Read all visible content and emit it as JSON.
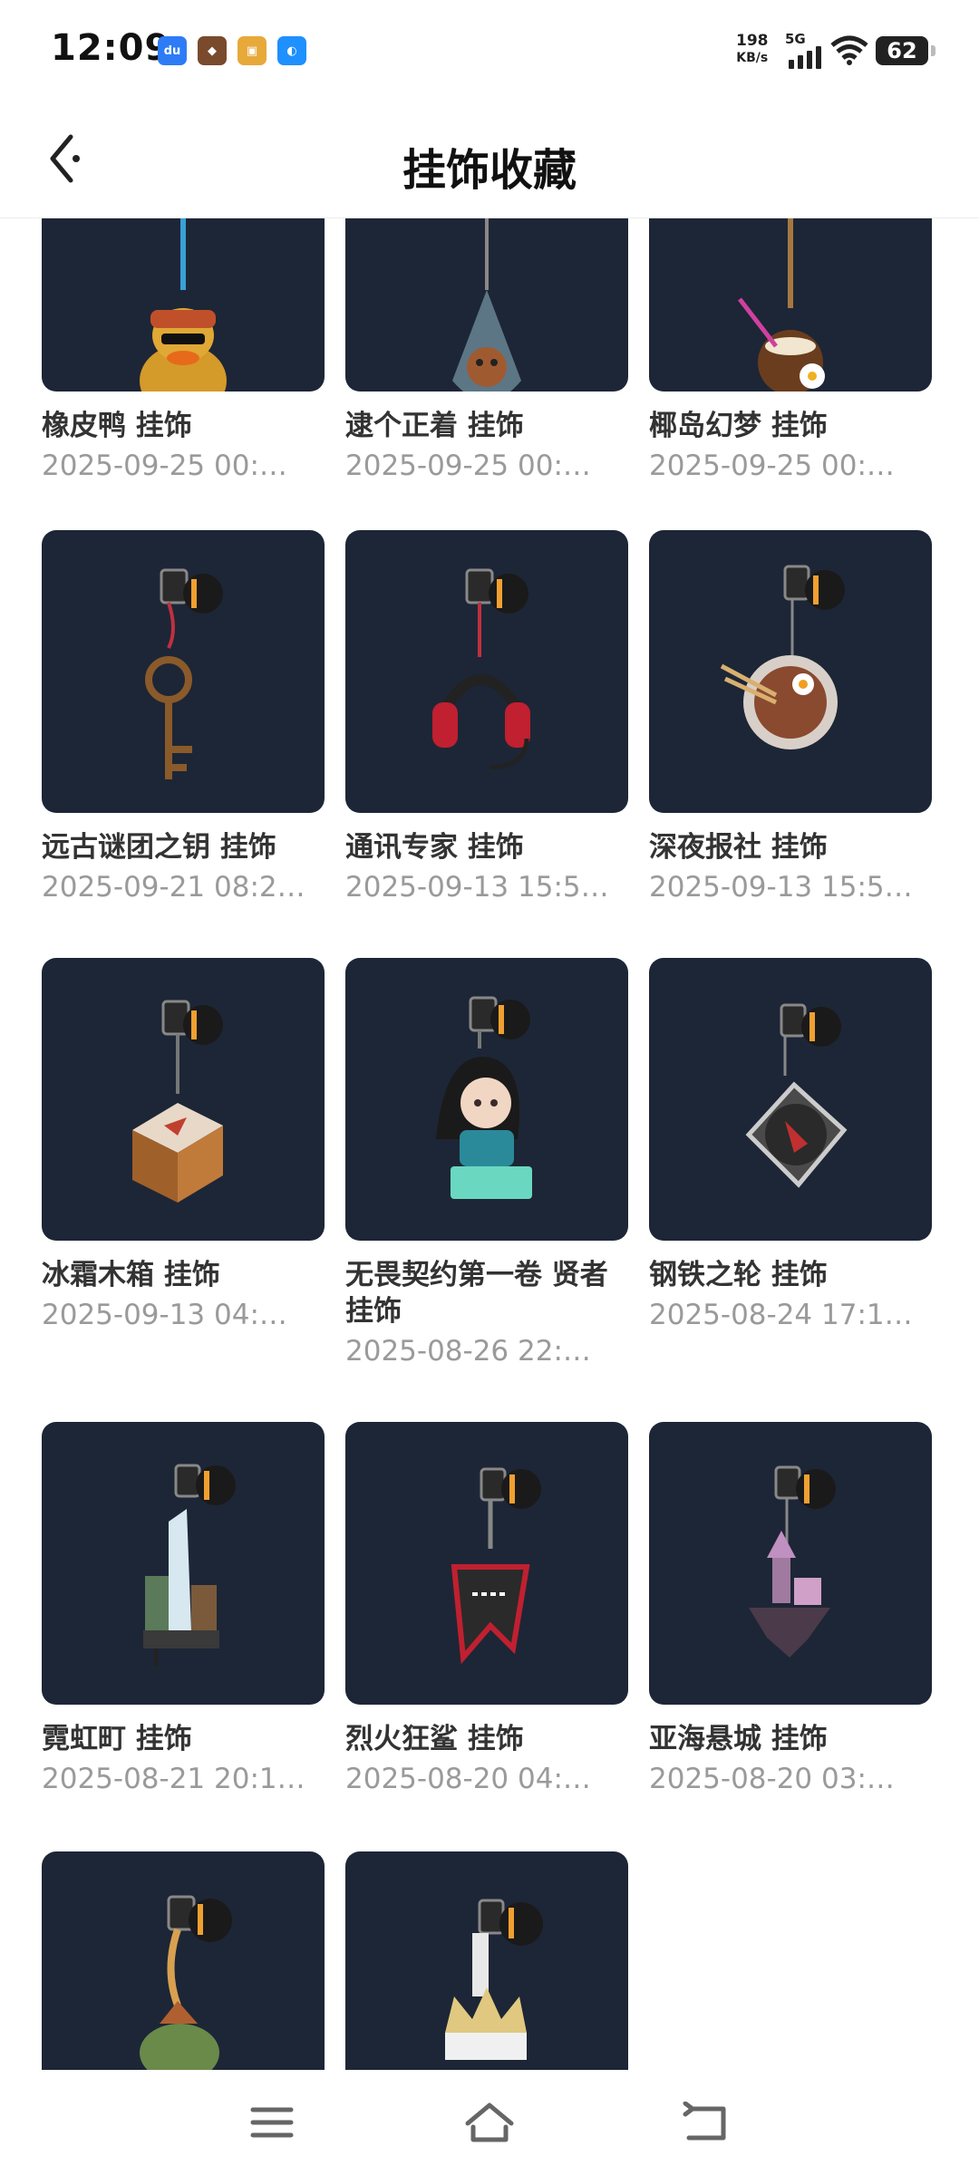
{
  "status_bar": {
    "time": "12:09",
    "notifications": [
      "du",
      "game",
      "game2",
      "browser"
    ],
    "net_speed": "198",
    "net_unit": "KB/s",
    "network": "5G",
    "battery": "62"
  },
  "header": {
    "title": "挂饰收藏"
  },
  "items": [
    {
      "name": "橡皮鸭 挂饰",
      "date": "2025-09-25 00:…",
      "icon": "rubber-duck-charm"
    },
    {
      "name": "逮个正着 挂饰",
      "date": "2025-09-25 00:…",
      "icon": "bag-creature-charm"
    },
    {
      "name": "椰岛幻梦 挂饰",
      "date": "2025-09-25 00:…",
      "icon": "coconut-drink-charm"
    },
    {
      "name": "远古谜团之钥 挂饰",
      "date": "2025-09-21 08:2…",
      "icon": "ancient-key-charm"
    },
    {
      "name": "通讯专家 挂饰",
      "date": "2025-09-13 15:5…",
      "icon": "headset-charm"
    },
    {
      "name": "深夜报社 挂饰",
      "date": "2025-09-13 15:5…",
      "icon": "noodle-bowl-charm"
    },
    {
      "name": "冰霜木箱 挂饰",
      "date": "2025-09-13 04:…",
      "icon": "wooden-crate-charm"
    },
    {
      "name": "无畏契约第一卷 贤者 挂饰",
      "date": "2025-08-26 22:…",
      "icon": "sage-figure-charm"
    },
    {
      "name": "钢铁之轮 挂饰",
      "date": "2025-08-24 17:1…",
      "icon": "turntable-charm"
    },
    {
      "name": "霓虹町 挂饰",
      "date": "2025-08-21 20:1…",
      "icon": "city-tower-charm"
    },
    {
      "name": "烈火狂鲨 挂饰",
      "date": "2025-08-20 04:…",
      "icon": "shark-charm"
    },
    {
      "name": "亚海悬城 挂饰",
      "date": "2025-08-20 03:…",
      "icon": "floating-island-charm"
    },
    {
      "name": "",
      "date": "",
      "icon": "frog-charm"
    },
    {
      "name": "",
      "date": "",
      "icon": "crown-charm"
    }
  ],
  "nav": {
    "menu_icon": "menu-icon",
    "home_icon": "home-icon",
    "back_icon": "back-nav-icon"
  },
  "colors": {
    "tile_bg": "#1d2636",
    "accent": "#f0a030"
  }
}
